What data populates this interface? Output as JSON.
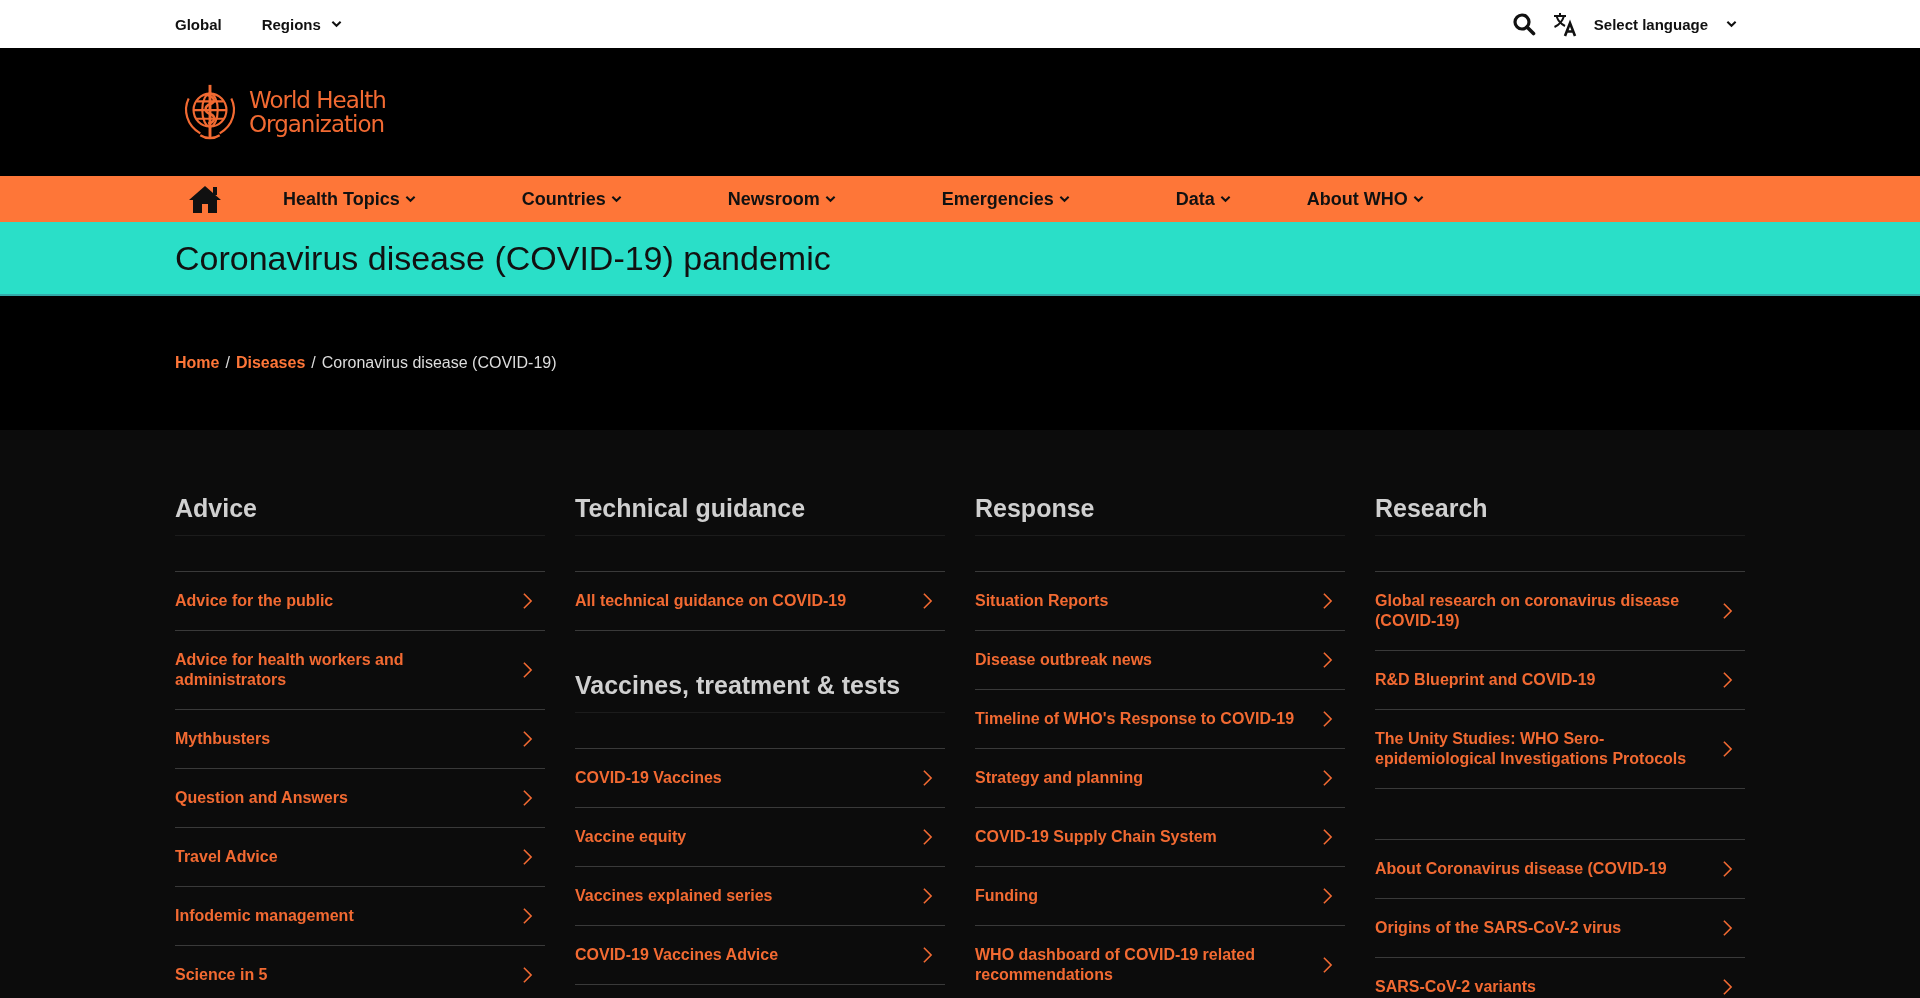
{
  "top_bar": {
    "links": [
      {
        "label": "Global",
        "has_menu": false
      },
      {
        "label": "Regions",
        "has_menu": true
      }
    ],
    "language": {
      "label": "Select language"
    }
  },
  "logo": {
    "name_lines": [
      "World Health",
      "Organization"
    ]
  },
  "nav": {
    "items": [
      {
        "label": "Health Topics"
      },
      {
        "label": "Countries"
      },
      {
        "label": "Newsroom"
      },
      {
        "label": "Emergencies"
      },
      {
        "label": "Data"
      },
      {
        "label": "About WHO"
      }
    ]
  },
  "page_title": "Coronavirus disease (COVID-19) pandemic",
  "breadcrumb": [
    {
      "kind": "link",
      "label": "Home"
    },
    {
      "kind": "separator",
      "label": "/"
    },
    {
      "kind": "link",
      "label": "Diseases"
    },
    {
      "kind": "separator",
      "label": "/"
    },
    {
      "kind": "current",
      "label": "Coronavirus disease (COVID-19)"
    }
  ],
  "columns": [
    {
      "groups": [
        {
          "heading": "Advice",
          "links": [
            "Advice for the public",
            "Advice for health workers and administrators",
            "Mythbusters",
            "Question and Answers",
            "Travel Advice",
            "Infodemic management",
            "Science in 5"
          ]
        }
      ]
    },
    {
      "groups": [
        {
          "heading": "Technical guidance",
          "links": [
            "All technical guidance on COVID-19"
          ]
        },
        {
          "heading": "Vaccines, treatment & tests",
          "links": [
            "COVID-19 Vaccines",
            "Vaccine equity",
            "Vaccines explained series",
            "COVID-19 Vaccines Advice"
          ]
        }
      ]
    },
    {
      "groups": [
        {
          "heading": "Response",
          "links": [
            "Situation Reports",
            "Disease outbreak news",
            "Timeline of WHO's Response to COVID-19",
            "Strategy and planning",
            "COVID-19 Supply Chain System",
            "Funding",
            "WHO dashboard of COVID-19 related recommendations"
          ]
        }
      ]
    },
    {
      "groups": [
        {
          "heading": "Research",
          "links": [
            "Global research on coronavirus disease (COVID-19)",
            "R&D Blueprint and COVID-19",
            "The Unity Studies: WHO Sero-epidemiological Investigations Protocols"
          ]
        },
        {
          "links": [
            "About Coronavirus disease (COVID-19",
            "Origins of the SARS-CoV-2 virus",
            "SARS-CoV-2 variants"
          ]
        }
      ]
    }
  ]
}
